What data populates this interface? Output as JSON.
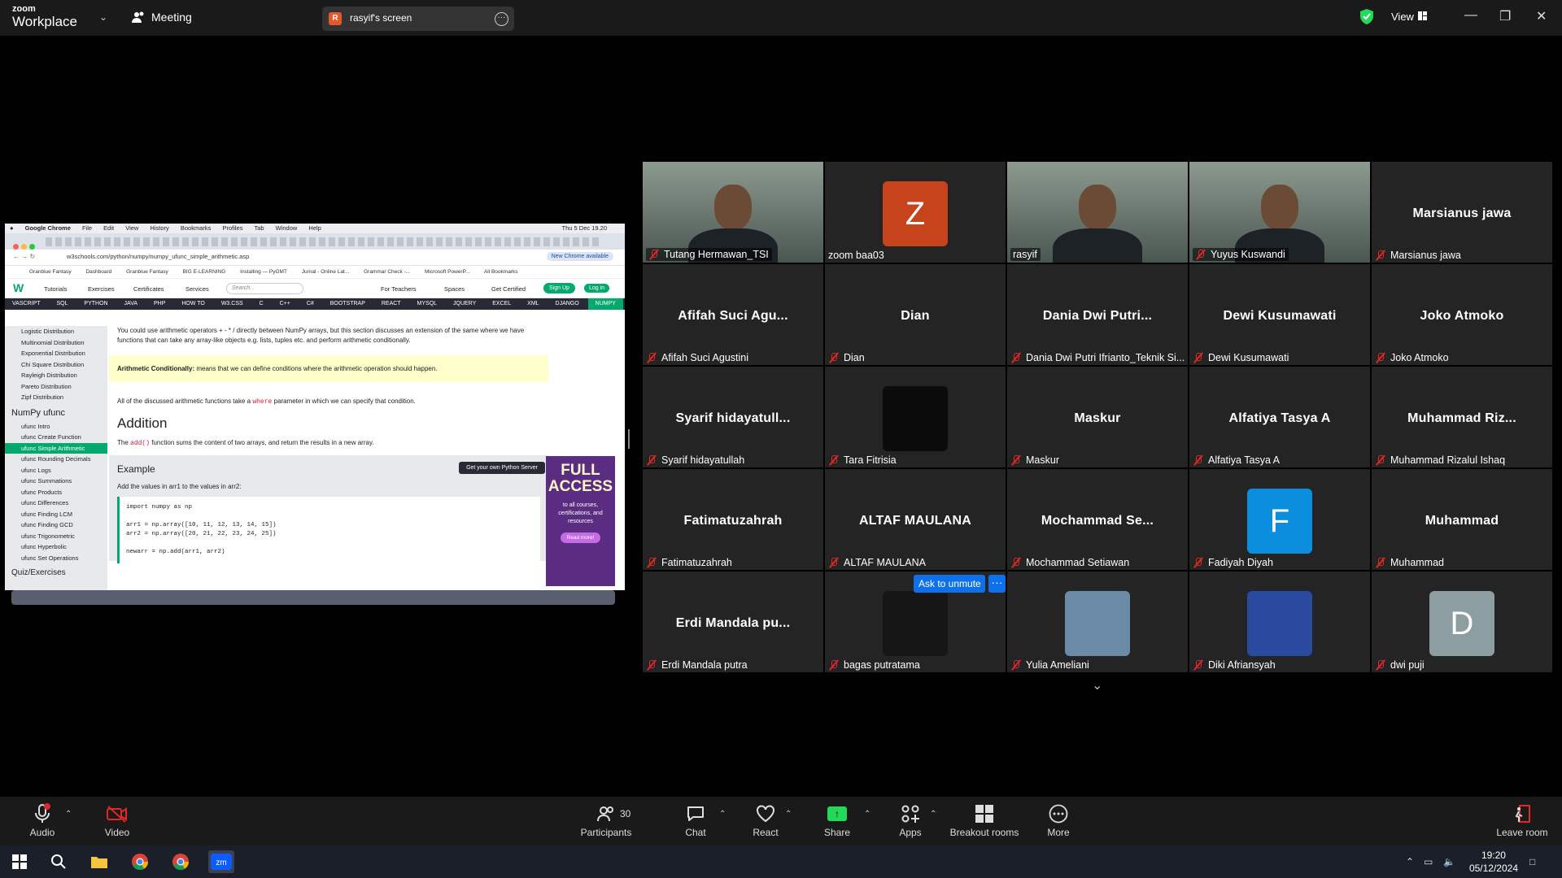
{
  "app": {
    "brand_top": "zoom",
    "brand_bottom": "Workplace",
    "meeting_label": "Meeting",
    "screen_initial": "R",
    "screen_label": "rasyif's screen",
    "view_label": "View"
  },
  "shared_screen": {
    "mac_menu": [
      "Google Chrome",
      "File",
      "Edit",
      "View",
      "History",
      "Bookmarks",
      "Profiles",
      "Tab",
      "Window",
      "Help"
    ],
    "mac_clock": "Thu 5 Dec 19.20",
    "url": "w3schools.com/python/numpy/numpy_ufunc_simple_arithmetic.asp",
    "chrome_chip": "New Chrome available",
    "bookmarks": [
      "Granblue Fantasy",
      "Dashboard",
      "Granblue Fantasy",
      "BIG E-LEARNING",
      "Installing — PyGMT",
      "Jurnal - Online Lat...",
      "Grammar Check -...",
      "Microsoft PowerP...",
      "All Bookmarks"
    ],
    "nav": {
      "tutorials": "Tutorials",
      "exercises": "Exercises",
      "certificates": "Certificates",
      "services": "Services",
      "search_placeholder": "Search...",
      "for_teachers": "For Teachers",
      "spaces": "Spaces",
      "get_certified": "Get Certified",
      "signup": "Sign Up",
      "login": "Log in"
    },
    "topics": [
      "VASCRIPT",
      "SQL",
      "PYTHON",
      "JAVA",
      "PHP",
      "HOW TO",
      "W3.CSS",
      "C",
      "C++",
      "C#",
      "BOOTSTRAP",
      "REACT",
      "MYSQL",
      "JQUERY",
      "EXCEL",
      "XML",
      "DJANGO",
      "NUMPY"
    ],
    "sidebar_top": [
      "Logistic Distribution",
      "Multinomial Distribution",
      "Exponential Distribution",
      "Chi Square Distribution",
      "Rayleigh Distribution",
      "Pareto Distribution",
      "Zipf Distribution"
    ],
    "sidebar_group": "NumPy ufunc",
    "sidebar_ufunc": [
      "ufunc Intro",
      "ufunc Create Function",
      "ufunc Simple Arithmetic",
      "ufunc Rounding Decimals",
      "ufunc Logs",
      "ufunc Summations",
      "ufunc Products",
      "ufunc Differences",
      "ufunc Finding LCM",
      "ufunc Finding GCD",
      "ufunc Trigonometric",
      "ufunc Hyperbolic",
      "ufunc Set Operations"
    ],
    "sidebar_footer": "Quiz/Exercises",
    "intro_text": "You could use arithmetic operators + - * / directly between NumPy arrays, but this section discusses an extension of the same where we have functions that can take any array-like objects e.g. lists, tuples etc. and perform arithmetic conditionally.",
    "note_bold": "Arithmetic Conditionally:",
    "note_text": " means that we can define conditions where the arithmetic operation should happen.",
    "where_pre": "All of the discussed arithmetic functions take a ",
    "where_code": "where",
    "where_post": " parameter in which we can specify that condition.",
    "heading": "Addition",
    "add_pre": "The ",
    "add_code": "add()",
    "add_post": " function sums the content of two arrays, and return the results in a new array.",
    "example_title": "Example",
    "python_server": "Get your own Python Server",
    "example_desc": "Add the values in arr1 to the values in arr2:",
    "code_lines": [
      "import numpy as np",
      "",
      "arr1 = np.array([10, 11, 12, 13, 14, 15])",
      "arr2 = np.array([20, 21, 22, 23, 24, 25])",
      "",
      "newarr = np.add(arr1, arr2)"
    ],
    "ad_big": "FULL ACCESS",
    "ad_small": "to all courses, certifications, and resources",
    "ad_button": "Read more!"
  },
  "participants": [
    {
      "name": "Tutang Hermawan_TSI",
      "display": "",
      "type": "video",
      "muted": true
    },
    {
      "name": "zoom baa03",
      "display": "",
      "type": "avatar",
      "avatar_letter": "Z",
      "avatar_color": "#c7431b",
      "muted": false
    },
    {
      "name": "rasyif",
      "display": "",
      "type": "video",
      "speaking": true,
      "muted": false
    },
    {
      "name": "Yuyus Kuswandi",
      "display": "",
      "type": "video",
      "muted": true
    },
    {
      "name": "Marsianus jawa",
      "display": "Marsianus jawa",
      "type": "name",
      "muted": true
    },
    {
      "name": "Afifah Suci Agustini",
      "display": "Afifah Suci Agu...",
      "type": "name",
      "muted": true
    },
    {
      "name": "Dian",
      "display": "Dian",
      "type": "name",
      "muted": true
    },
    {
      "name": "Dania Dwi Putri Ifrianto_Teknik Si...",
      "display": "Dania Dwi Putri...",
      "type": "name",
      "muted": true
    },
    {
      "name": "Dewi Kusumawati",
      "display": "Dewi Kusumawati",
      "type": "name",
      "muted": true
    },
    {
      "name": "Joko Atmoko",
      "display": "Joko Atmoko",
      "type": "name",
      "muted": true
    },
    {
      "name": "Syarif hidayatullah",
      "display": "Syarif hidayatull...",
      "type": "name",
      "muted": true
    },
    {
      "name": "Tara Fitrisia",
      "display": "",
      "type": "avatar",
      "avatar_letter": "",
      "avatar_color": "#0b0b0b",
      "muted": true
    },
    {
      "name": "Maskur",
      "display": "Maskur",
      "type": "name",
      "muted": true
    },
    {
      "name": "Alfatiya Tasya A",
      "display": "Alfatiya Tasya A",
      "type": "name",
      "muted": true
    },
    {
      "name": "Muhammad Rizalul Ishaq",
      "display": "Muhammad Riz...",
      "type": "name",
      "muted": true
    },
    {
      "name": "Fatimatuzahrah",
      "display": "Fatimatuzahrah",
      "type": "name",
      "muted": true
    },
    {
      "name": "ALTAF MAULANA",
      "display": "ALTAF MAULANA",
      "type": "name",
      "muted": true
    },
    {
      "name": "Mochammad Setiawan",
      "display": "Mochammad Se...",
      "type": "name",
      "muted": true
    },
    {
      "name": "Fadiyah Diyah",
      "display": "",
      "type": "avatar",
      "avatar_letter": "F",
      "avatar_color": "#0b8ede",
      "muted": true
    },
    {
      "name": "Muhammad",
      "display": "Muhammad",
      "type": "name",
      "muted": true
    },
    {
      "name": "Erdi Mandala putra",
      "display": "Erdi Mandala pu...",
      "type": "name",
      "muted": true
    },
    {
      "name": "bagas putratama",
      "display": "",
      "type": "avatar",
      "avatar_letter": "",
      "avatar_color": "#161616",
      "muted": true
    },
    {
      "name": "Yulia Ameliani",
      "display": "",
      "type": "avatar",
      "avatar_letter": "",
      "avatar_color": "#6b8aa6",
      "muted": true
    },
    {
      "name": "Diki Afriansyah",
      "display": "",
      "type": "avatar",
      "avatar_letter": "",
      "avatar_color": "#2a4aa0",
      "muted": true
    },
    {
      "name": "dwi puji",
      "display": "",
      "type": "avatar",
      "avatar_letter": "D",
      "avatar_color": "#8d9ea3",
      "muted": true
    }
  ],
  "ask_unmute": "Ask to unmute",
  "ask_more": "···",
  "toolbar": {
    "audio": "Audio",
    "video": "Video",
    "participants": "Participants",
    "participants_count": "30",
    "chat": "Chat",
    "react": "React",
    "share": "Share",
    "apps": "Apps",
    "breakout": "Breakout rooms",
    "more": "More",
    "leave": "Leave room"
  },
  "taskbar": {
    "time": "19:20",
    "date": "05/12/2024"
  },
  "colors": {
    "speaking_outline": "#23d959",
    "zoom_blue": "#0e71eb",
    "w3_green": "#04aa6d"
  }
}
